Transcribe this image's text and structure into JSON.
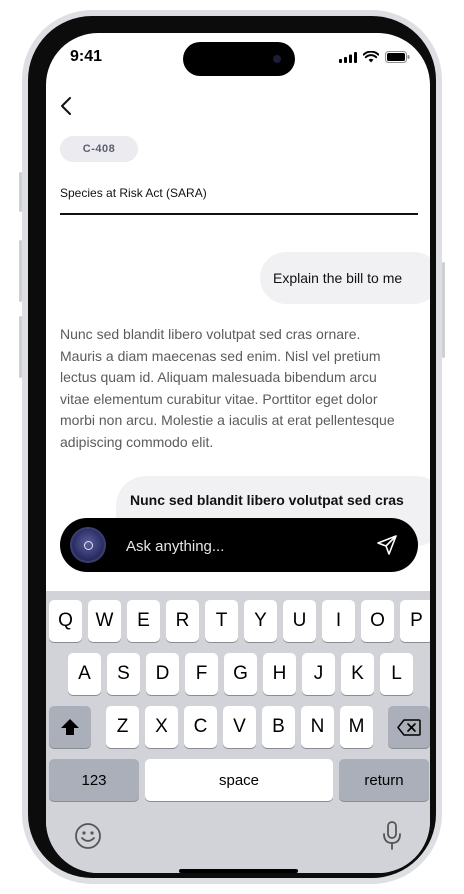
{
  "status_bar": {
    "time": "9:41"
  },
  "header": {
    "back_icon": "chevron-left-icon"
  },
  "bill": {
    "code": "C-408",
    "title": "Species at Risk Act (SARA)"
  },
  "messages": [
    {
      "role": "user",
      "text": "Explain the bill to me"
    },
    {
      "role": "assistant",
      "text": "Nunc sed blandit libero volutpat sed cras ornare. Mauris a diam maecenas sed enim. Nisl vel pretium lectus quam id. Aliquam malesuada bibendum arcu vitae elementum curabitur vitae. Porttitor eget dolor morbi non arcu. Molestie a iaculis at erat pellentesque adipiscing commodo elit."
    },
    {
      "role": "user",
      "text": "Nunc sed blandit libero volutpat sed cras"
    }
  ],
  "chat_input": {
    "placeholder": "Ask anything..."
  },
  "keyboard": {
    "row1": [
      "Q",
      "W",
      "E",
      "R",
      "T",
      "Y",
      "U",
      "I",
      "O",
      "P"
    ],
    "row2": [
      "A",
      "S",
      "D",
      "F",
      "G",
      "H",
      "J",
      "K",
      "L"
    ],
    "row3": [
      "Z",
      "X",
      "C",
      "V",
      "B",
      "N",
      "M"
    ],
    "numbers_label": "123",
    "space_label": "space",
    "return_label": "return"
  },
  "colors": {
    "accent_dark": "#000000",
    "chip_bg": "#ececf0",
    "keyboard_bg": "#d1d3d9"
  }
}
